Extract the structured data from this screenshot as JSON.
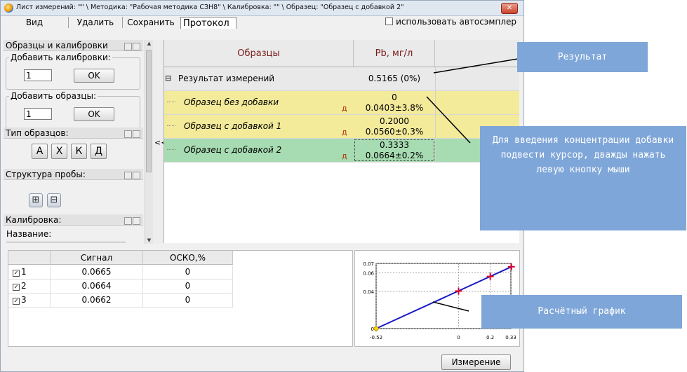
{
  "window": {
    "title": "Лист измерений: \"\" \\ Методика: \"Рабочая методика СЗН8\" \\ Калибровка: \"\" \\ Образец: \"Образец с добавкой 2\"",
    "close_glyph": "✕"
  },
  "menu": {
    "items": [
      "Вид",
      "Удалить",
      "Сохранить"
    ],
    "active_tab": "Протокол",
    "autosampler_label": "использовать автосэмплер"
  },
  "left_panel": {
    "samples_section": "Образцы и калибровки",
    "add_calibration_label": "Добавить калибровки:",
    "add_calibration_value": "1",
    "add_samples_label": "Добавить образцы:",
    "add_samples_value": "1",
    "ok_label": "OK",
    "type_section": "Тип образцов:",
    "type_buttons": [
      "А",
      "Х",
      "К",
      "Д"
    ],
    "structure_section": "Структура пробы:",
    "structure_buttons": [
      "⊞",
      "⊟"
    ],
    "calibration_section": "Калибровка:",
    "name_label": "Название:"
  },
  "splitter_glyph": "<<",
  "results_grid": {
    "headers": [
      "Образцы",
      "Pb, мг/л"
    ],
    "rows": [
      {
        "name": "Результат измерений",
        "line1": "0.5165 (0%)",
        "line2": "",
        "marker": "",
        "color": "#e9e9e9",
        "expand": "⊟"
      },
      {
        "name": "Образец без добавки",
        "line1": "0",
        "line2": "0.0403±3.8%",
        "marker": "д",
        "color": "#f3ea9a",
        "expand": ""
      },
      {
        "name": "Образец с добавкой 1",
        "line1": "0.2000",
        "line2": "0.0560±0.3%",
        "marker": "д",
        "color": "#f3ea9a",
        "expand": ""
      },
      {
        "name": "Образец с добавкой 2",
        "line1": "0.3333",
        "line2": "0.0664±0.2%",
        "marker": "д",
        "color": "#a7dbb1",
        "expand": ""
      }
    ]
  },
  "signals_table": {
    "headers": [
      "",
      "Сигнал",
      "ОСКО,%"
    ],
    "rows": [
      {
        "id": "1",
        "signal": "0.0665",
        "rsd": "0"
      },
      {
        "id": "2",
        "signal": "0.0664",
        "rsd": "0"
      },
      {
        "id": "3",
        "signal": "0.0662",
        "rsd": "0"
      }
    ]
  },
  "measure_button": "Измерение",
  "callouts": {
    "result": "Результат",
    "concentration": "Для введения концентрации добавки подвести курсор, дважды нажать левую кнопку мыши",
    "graph": "Расчётный график"
  },
  "chart_data": {
    "type": "scatter",
    "x_ticks": [
      "-0.52",
      "0",
      "0.2",
      "0.33"
    ],
    "y_ticks": [
      "0.07",
      "0.06",
      "0.04",
      "0"
    ],
    "xlim": [
      -0.52,
      0.33
    ],
    "ylim": [
      0,
      0.07
    ],
    "points": [
      {
        "x": 0,
        "y": 0.0403
      },
      {
        "x": 0.2,
        "y": 0.056
      },
      {
        "x": 0.3333,
        "y": 0.0664
      }
    ],
    "intercept_point": {
      "x": -0.52,
      "y": 0
    },
    "fit_line": [
      [
        -0.52,
        0
      ],
      [
        0.3333,
        0.0664
      ]
    ],
    "grid": true,
    "colors": {
      "points": "#e0002a",
      "line": "#1a1ac8",
      "intercept": "#f5d400"
    }
  }
}
